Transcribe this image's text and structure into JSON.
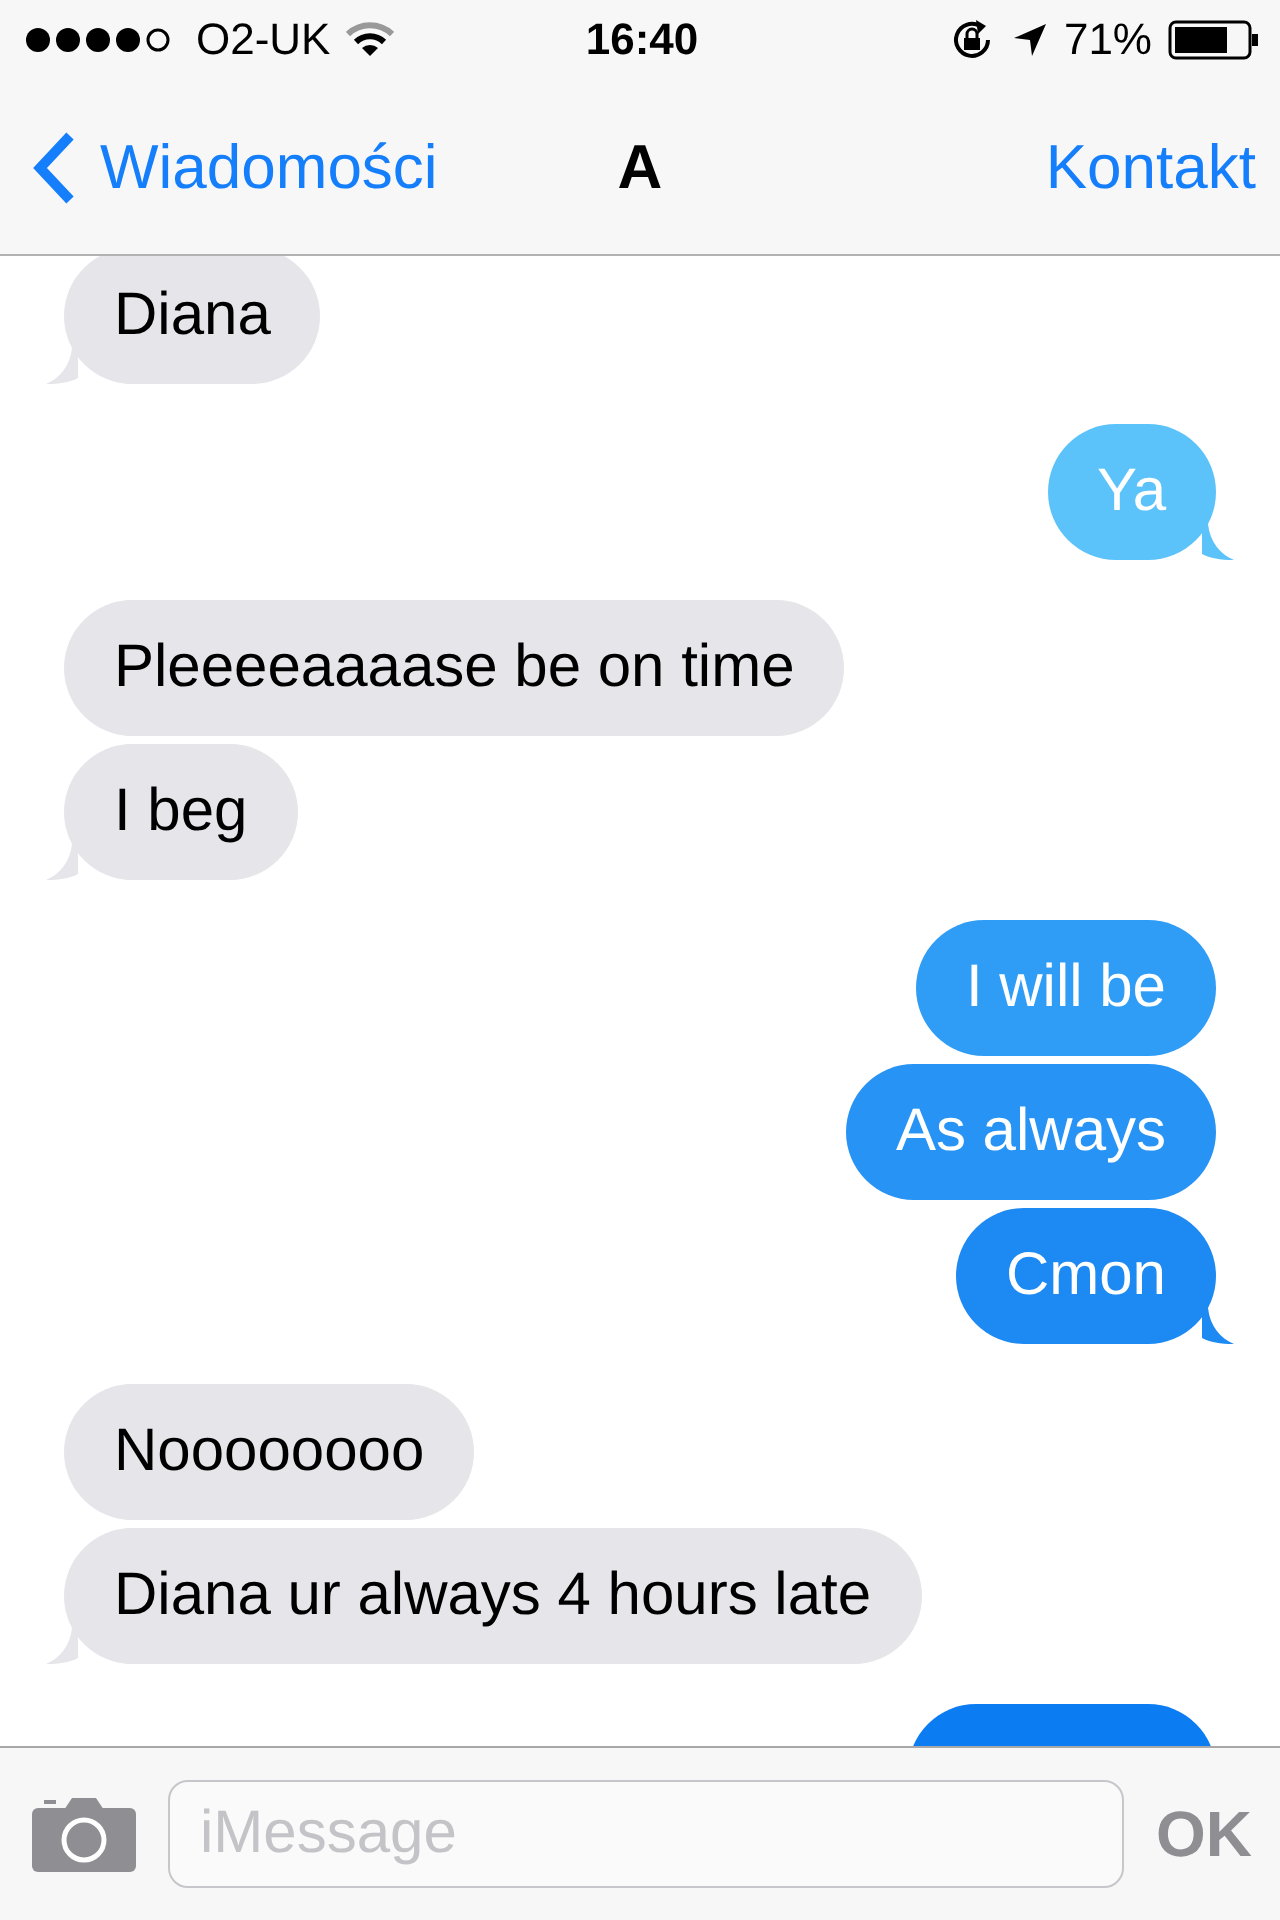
{
  "status_bar": {
    "carrier": "O2-UK",
    "time": "16:40",
    "battery": "71%"
  },
  "nav": {
    "back": "Wiadomości",
    "title": "A",
    "action": "Kontakt"
  },
  "messages": [
    {
      "kind": "received",
      "text": "Diana",
      "tail": true
    },
    {
      "kind": "sent",
      "text": "Ya",
      "tail": true,
      "color": "#5bc3fa"
    },
    {
      "kind": "received",
      "text": "Pleeeeaaaase be on time",
      "tail": false
    },
    {
      "kind": "received",
      "text": "I beg",
      "tail": true
    },
    {
      "kind": "sent",
      "text": "I will be",
      "tail": false,
      "color": "#2f9cf6"
    },
    {
      "kind": "sent",
      "text": "As always",
      "tail": false,
      "color": "#2793f4"
    },
    {
      "kind": "sent",
      "text": "Cmon",
      "tail": true,
      "color": "#1d89f2"
    },
    {
      "kind": "received",
      "text": "Noooooooo",
      "tail": false
    },
    {
      "kind": "received",
      "text": "Diana ur always 4 hours late",
      "tail": true
    },
    {
      "kind": "sent",
      "color": "#0b7cf1"
    }
  ],
  "composer": {
    "placeholder": "iMessage",
    "send": "OK"
  }
}
